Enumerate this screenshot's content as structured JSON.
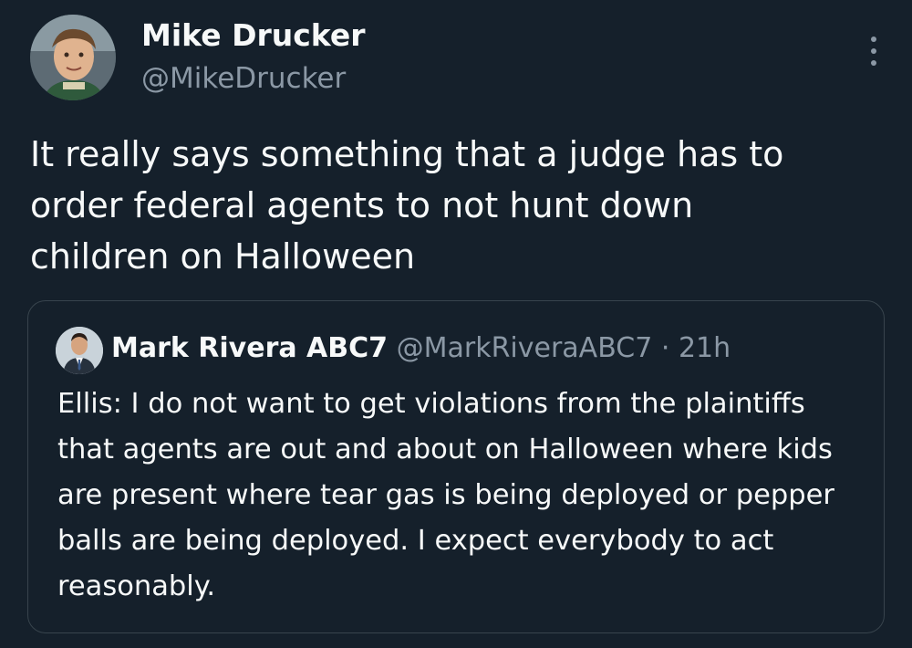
{
  "tweet": {
    "author_name": "Mike Drucker",
    "author_handle": "@MikeDrucker",
    "text": "It really says something that a judge has to order federal agents to not hunt down children on Halloween",
    "avatar_icon": "user-photo-avatar",
    "more_icon": "more-options-icon"
  },
  "quoted_tweet": {
    "author_name": "Mark Rivera ABC7",
    "author_handle": "@MarkRiveraABC7",
    "separator": "·",
    "time": "21h",
    "text": "Ellis: I do not want to get violations from the plaintiffs that agents are out and about on Halloween where kids are present where tear gas is being deployed or pepper balls are being deployed. I expect everybody to act reasonably.",
    "avatar_icon": "user-photo-avatar"
  },
  "colors": {
    "background": "#15202b",
    "primary_text": "#f7f9f9",
    "secondary_text": "#8b98a5",
    "border": "#38444d"
  }
}
